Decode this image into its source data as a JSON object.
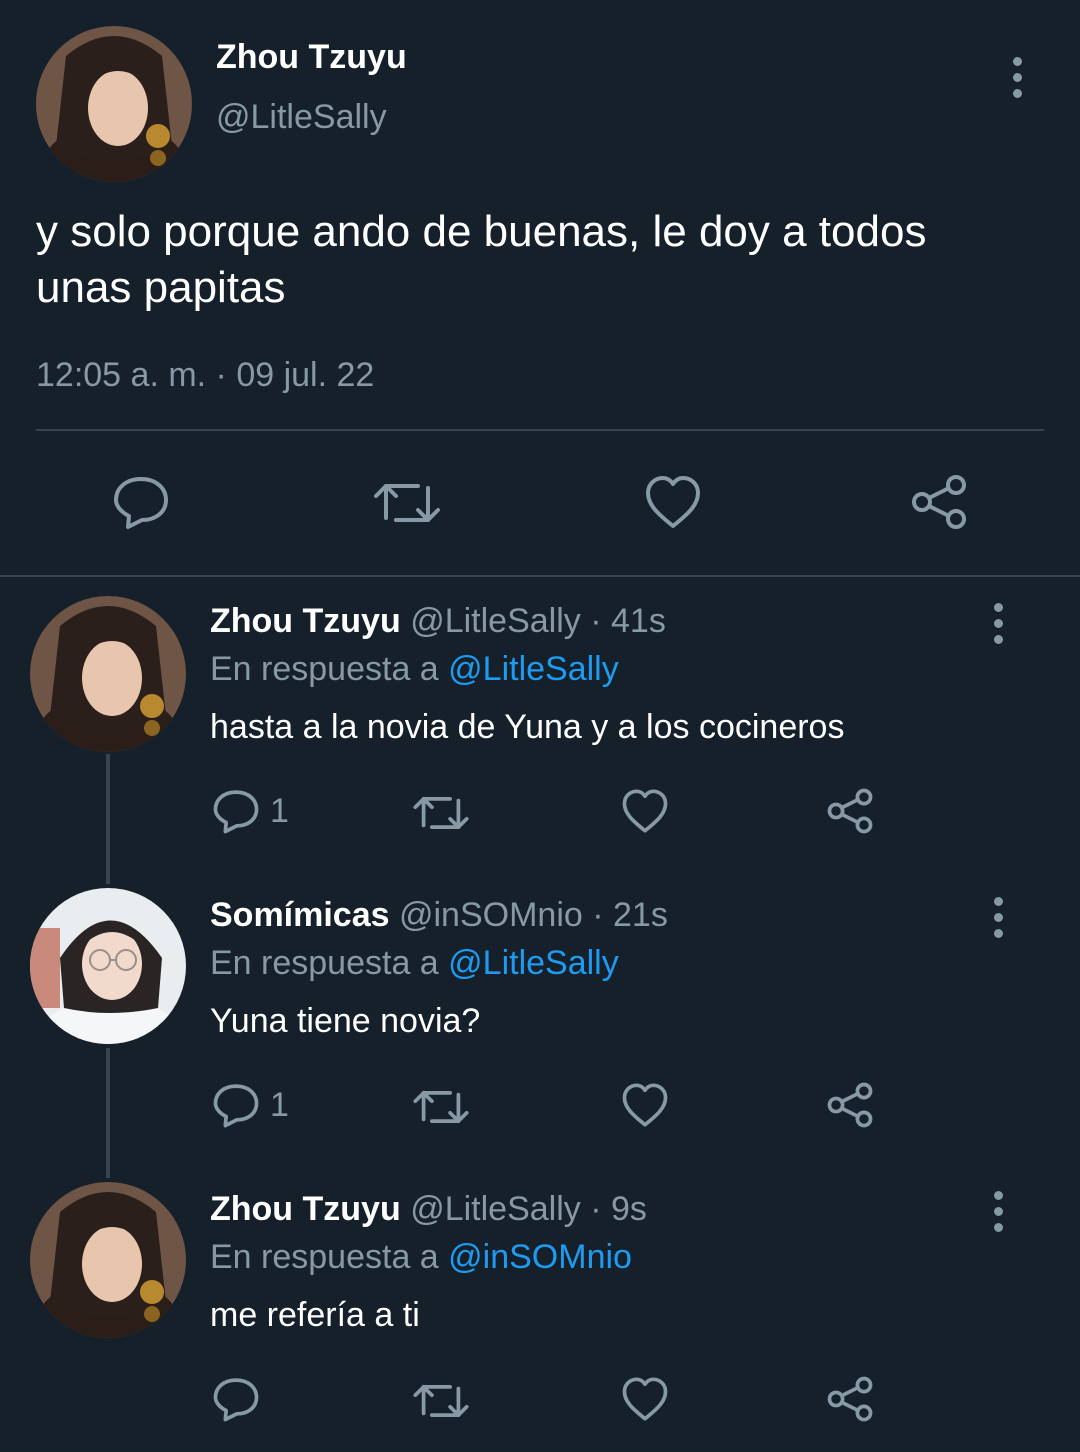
{
  "main_tweet": {
    "display_name": "Zhou Tzuyu",
    "handle": "@LitleSally",
    "text": "y solo porque ando de buenas, le doy a todos unas papitas",
    "timestamp": "12:05 a. m. · 09 jul. 22"
  },
  "icons": {
    "reply": "reply-icon",
    "retweet": "retweet-icon",
    "like": "like-icon",
    "share": "share-icon",
    "more": "more-icon"
  },
  "colors": {
    "background": "#15202b",
    "muted": "#8899a6",
    "link": "#1d9bf0",
    "divider": "#38444d"
  },
  "replies": [
    {
      "display_name": "Zhou Tzuyu",
      "handle": "@LitleSally",
      "time": "· 41s",
      "reply_prefix": "En respuesta a",
      "reply_to": "@LitleSally",
      "text": "hasta a la novia de Yuna y a los cocineros",
      "reply_count": "1"
    },
    {
      "display_name": "Somímicas",
      "handle": "@inSOMnio",
      "time": "· 21s",
      "reply_prefix": "En respuesta a",
      "reply_to": "@LitleSally",
      "text": "Yuna tiene novia?",
      "reply_count": "1"
    },
    {
      "display_name": "Zhou Tzuyu",
      "handle": "@LitleSally",
      "time": "· 9s",
      "reply_prefix": "En respuesta a",
      "reply_to": "@inSOMnio",
      "text": "me refería a ti",
      "reply_count": ""
    }
  ]
}
